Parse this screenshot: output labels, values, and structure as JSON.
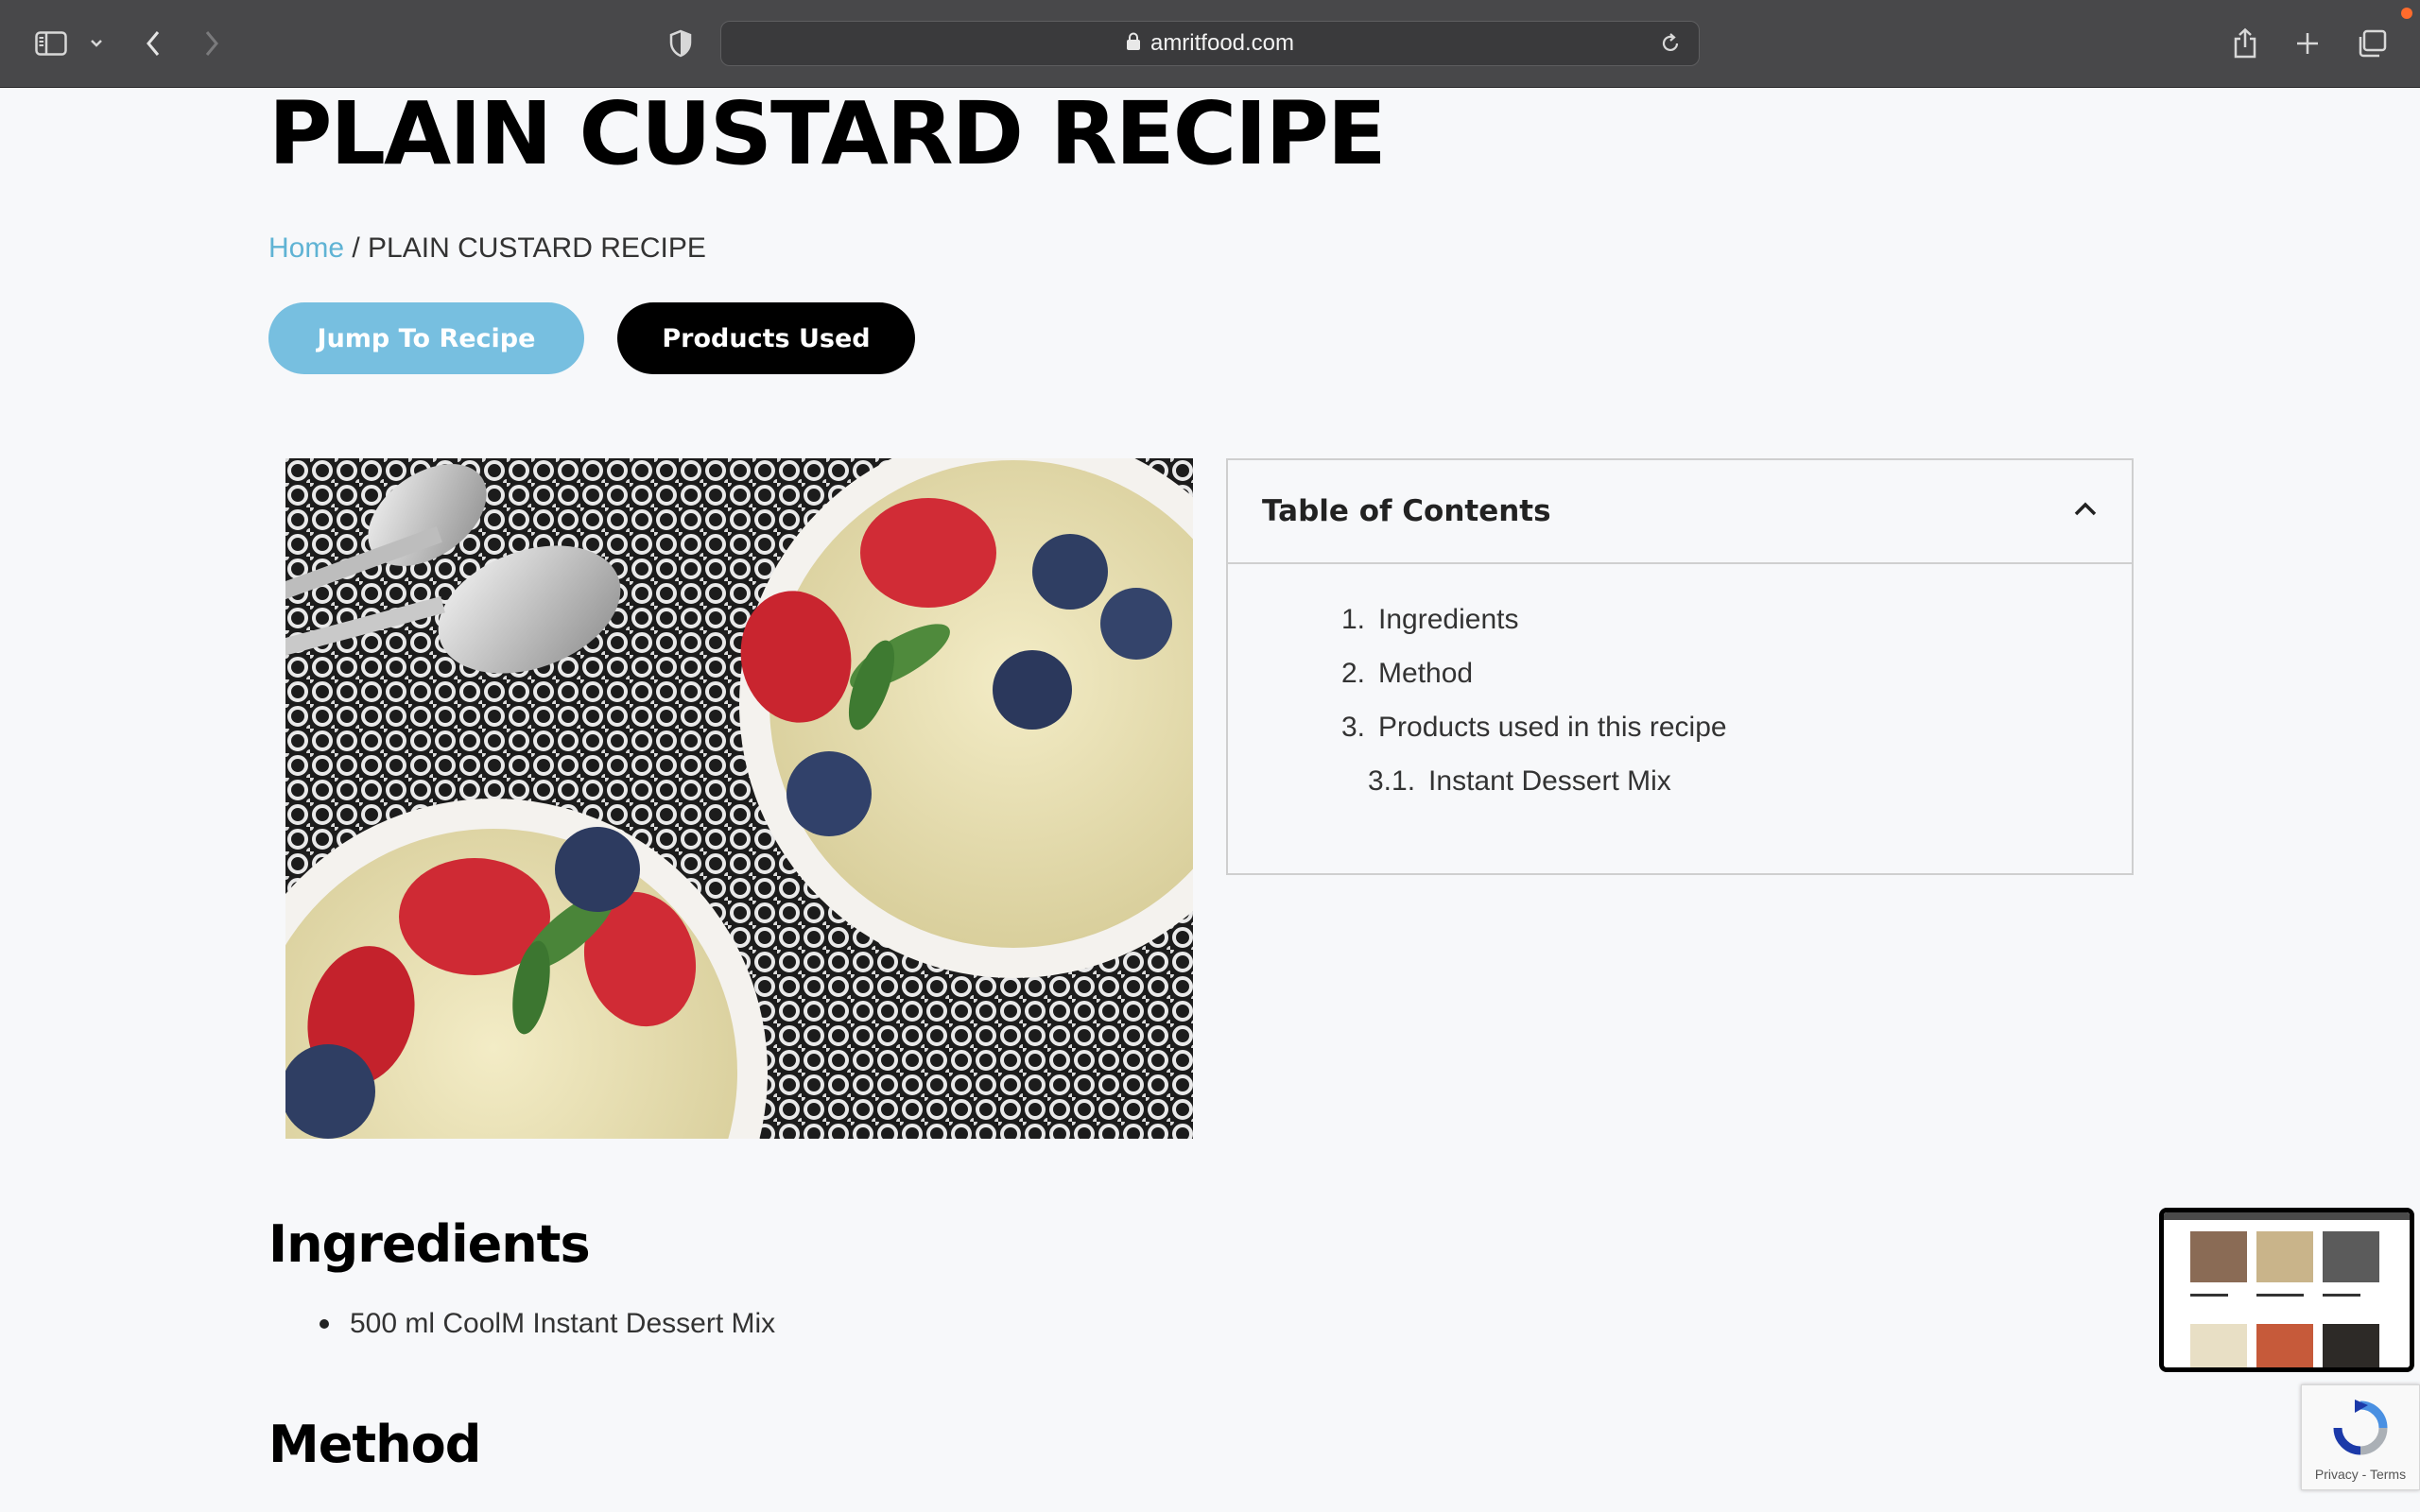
{
  "browser": {
    "url": "amritfood.com",
    "icons": {
      "sidebar": "sidebar-icon",
      "tab_menu": "chevron-down-icon",
      "back": "back-arrow-icon",
      "forward": "forward-arrow-icon",
      "privacy": "shield-icon",
      "lock": "lock-icon",
      "reload": "reload-icon",
      "share": "share-icon",
      "new_tab": "plus-icon",
      "tabs": "tabs-overview-icon"
    }
  },
  "page": {
    "title": "PLAIN CUSTARD RECIPE",
    "breadcrumb": {
      "home": "Home",
      "separator": " / ",
      "current": "PLAIN CUSTARD RECIPE"
    },
    "buttons": {
      "jump": "Jump To Recipe",
      "products": "Products Used"
    },
    "toc": {
      "title": "Table of Contents",
      "items": [
        {
          "num": "1.",
          "label": "Ingredients"
        },
        {
          "num": "2.",
          "label": "Method"
        },
        {
          "num": "3.",
          "label": "Products used in this recipe"
        },
        {
          "num": "3.1.",
          "label": "Instant Dessert Mix"
        }
      ]
    },
    "ingredients": {
      "heading": "Ingredients",
      "items": [
        "500 ml CoolM Instant Dessert Mix"
      ]
    },
    "method": {
      "heading": "Method"
    }
  },
  "recaptcha": {
    "text": "Privacy - Terms"
  },
  "colors": {
    "accent": "#77bfe0",
    "link": "#5fb3d4",
    "toolbar": "#48484a"
  }
}
